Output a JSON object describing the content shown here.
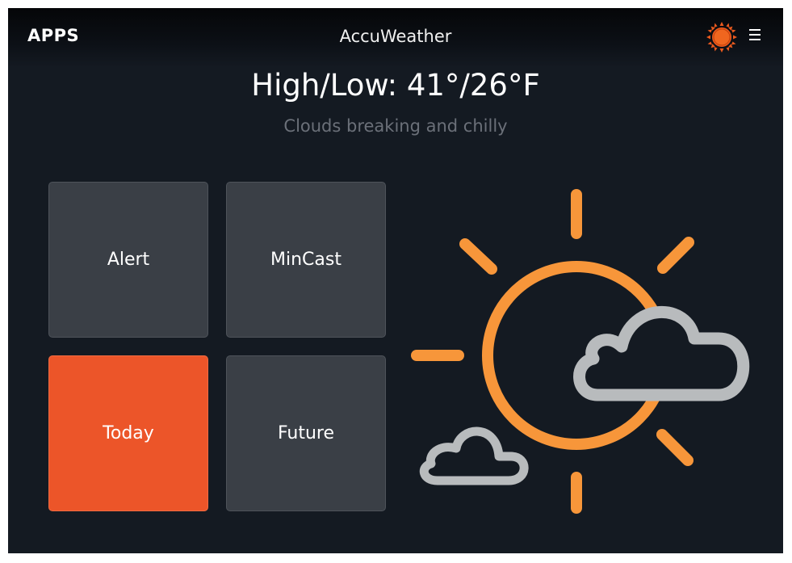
{
  "header": {
    "apps_label": "APPS",
    "title": "AccuWeather",
    "logo_icon": "accuweather-sun-logo-icon",
    "menu_icon": "hamburger-menu-icon"
  },
  "forecast": {
    "high_low": "High/Low: 41°/26°F",
    "condition": "Clouds breaking and chilly",
    "illustration_icon": "partly-cloudy-sun-icon"
  },
  "tiles": [
    {
      "label": "Alert",
      "active": false
    },
    {
      "label": "MinCast",
      "active": false
    },
    {
      "label": "Today",
      "active": true
    },
    {
      "label": "Future",
      "active": false
    }
  ],
  "colors": {
    "background": "#141a22",
    "tile": "#3a3f46",
    "tile_active": "#ec5529",
    "sun": "#f7963a",
    "cloud": "#b8bbbd",
    "logo": "#ec5a1e"
  }
}
